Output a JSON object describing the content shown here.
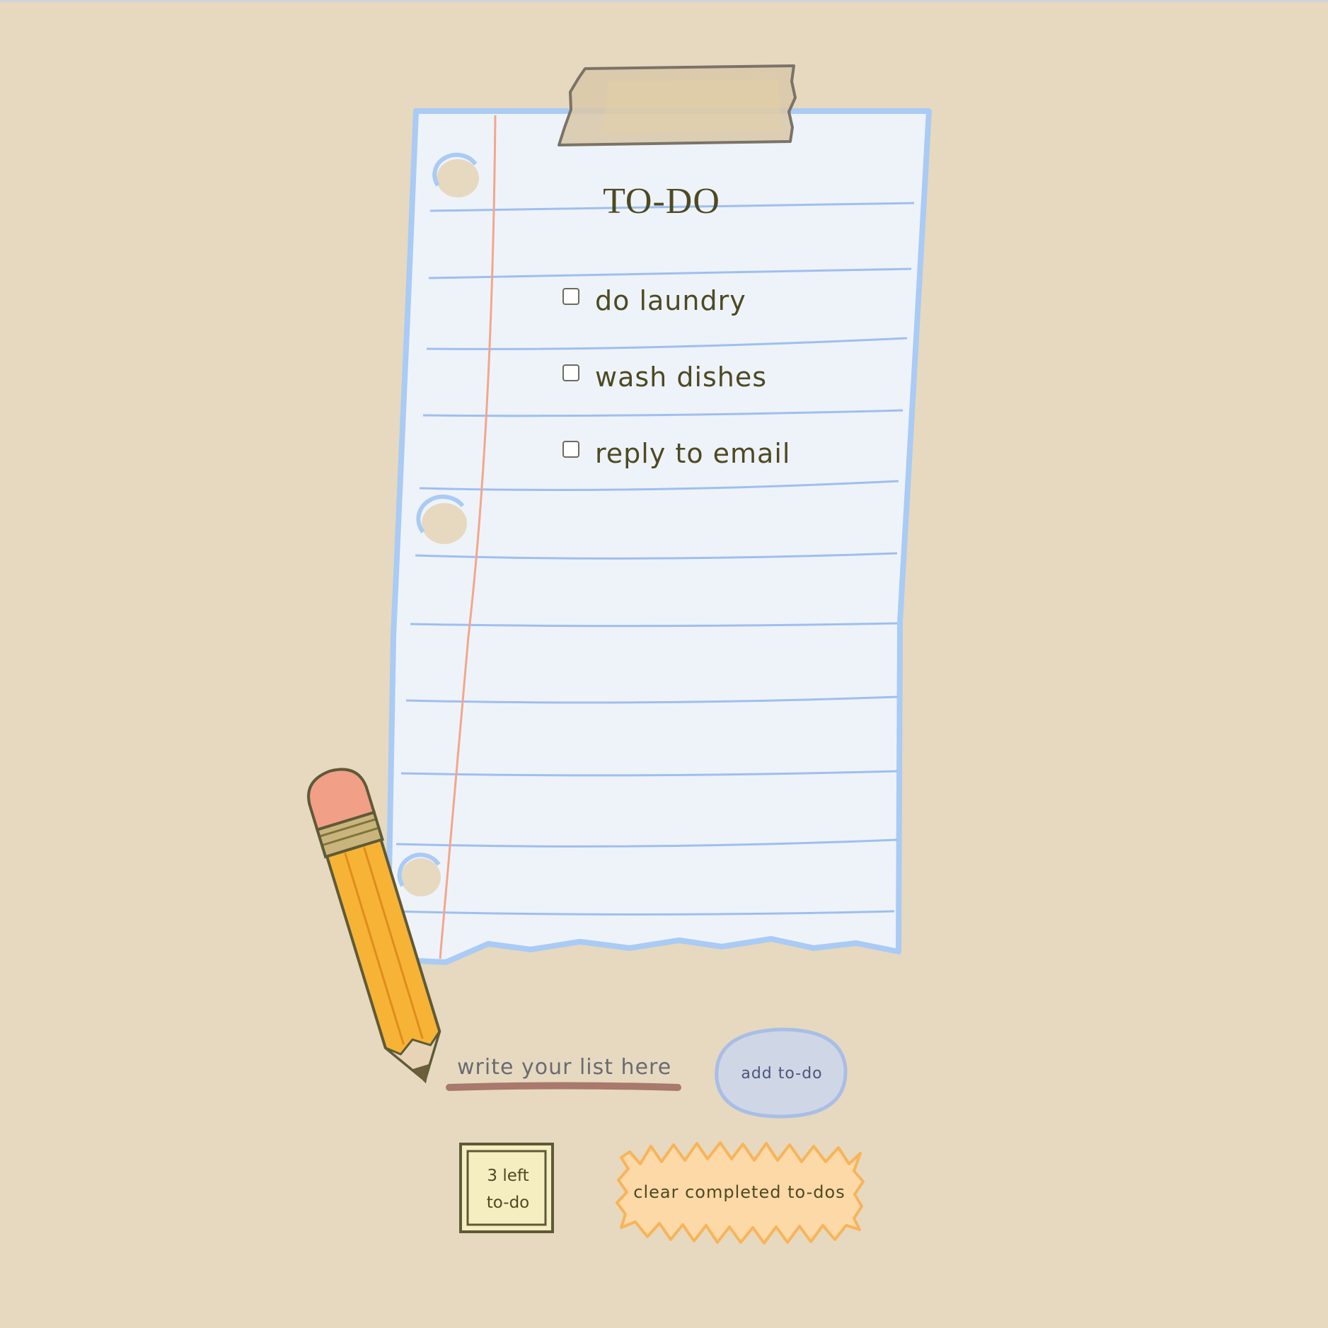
{
  "page": {
    "title": "TO-DO"
  },
  "todos": [
    {
      "text": "do laundry",
      "checked": false
    },
    {
      "text": "wash dishes",
      "checked": false
    },
    {
      "text": "reply to email",
      "checked": false
    }
  ],
  "input": {
    "placeholder": "write your list here",
    "value": ""
  },
  "add_button": {
    "label": "add to-do"
  },
  "counter": {
    "line1": "3 left",
    "line2": "to-do"
  },
  "clear_button": {
    "label": "clear completed to-dos"
  },
  "colors": {
    "background": "#e6d9bf",
    "paper": "#eef3fa",
    "paper_edge": "#a9cbf5",
    "ruled_line": "#9ebff0",
    "margin_line": "#f4a68c",
    "text": "#4d4a22",
    "tape": "#d9c9ab",
    "pencil_body": "#f7b335",
    "pencil_eraser": "#f29f88",
    "input_underline": "#a8796c",
    "add_button_fill": "#cfd6e6",
    "add_button_outline": "#a9bee6",
    "counter_fill": "#f5eec0",
    "clear_button_fill": "#fdd9a8",
    "clear_button_outline": "#f8b45a"
  },
  "icons": {
    "pencil": "pencil-icon",
    "tape": "tape-icon",
    "hole_punch": "hole-icon"
  }
}
